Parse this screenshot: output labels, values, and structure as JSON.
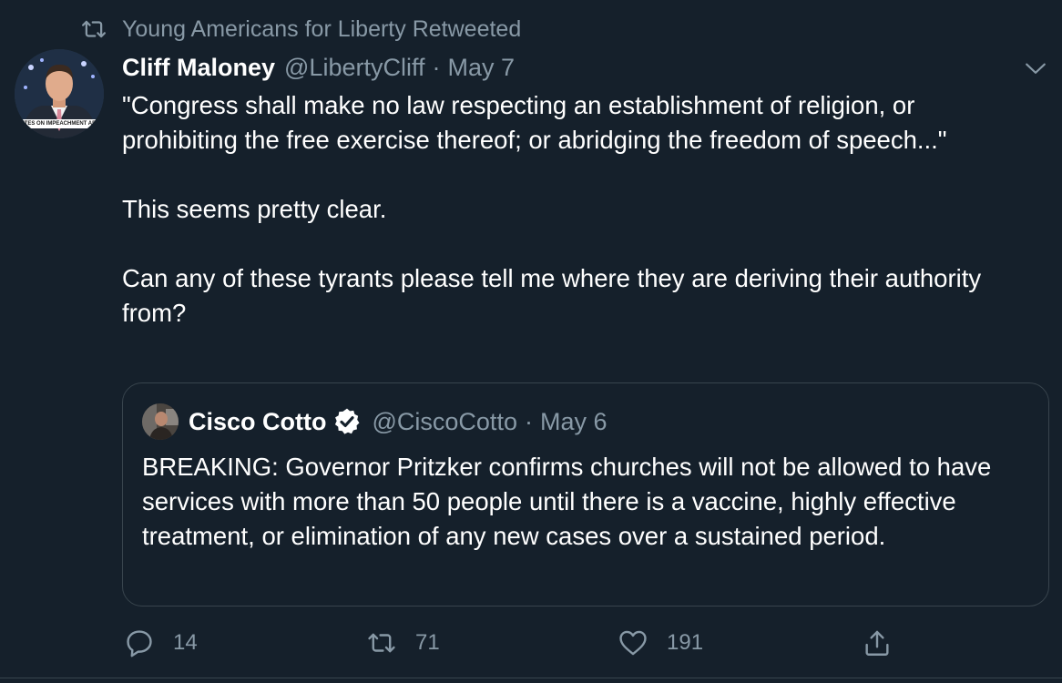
{
  "retweet_banner": {
    "text": "Young Americans for Liberty Retweeted"
  },
  "tweet": {
    "author_name": "Cliff Maloney",
    "author_handle": "@LibertyCliff",
    "separator": "·",
    "date": "May 7",
    "avatar_caption": "VOTES ON IMPEACHMENT AR",
    "body": {
      "paragraph_1": "\"Congress shall make no law respecting an establishment of religion, or prohibiting the free exercise thereof; or abridging the freedom of speech...\"",
      "paragraph_2": "This seems pretty clear.",
      "paragraph_3": "Can any of these tyrants please tell me where they are deriving their authority from?"
    }
  },
  "quoted_tweet": {
    "author_name": "Cisco Cotto",
    "verified": true,
    "author_handle": "@CiscoCotto",
    "separator": "·",
    "date": "May 6",
    "text": "BREAKING: Governor Pritzker confirms churches will not be allowed to have services with more than 50 people until there is a vaccine, highly effective treatment, or elimination of any new cases over a sustained period."
  },
  "actions": {
    "reply_count": "14",
    "retweet_count": "71",
    "like_count": "191"
  },
  "icons": {
    "retweet_banner": "retweet-icon",
    "menu": "chevron-down-icon",
    "verified": "verified-badge-icon",
    "reply": "reply-icon",
    "retweet": "retweet-icon",
    "like": "heart-icon",
    "share": "share-icon"
  },
  "colors": {
    "background": "#15202b",
    "primary_text": "#ffffff",
    "secondary_text": "#8899a6",
    "border": "#38444d"
  }
}
